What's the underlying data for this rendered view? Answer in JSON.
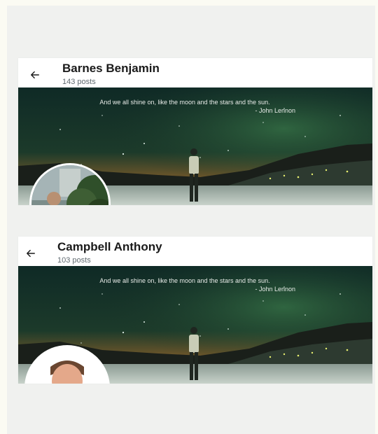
{
  "profiles": [
    {
      "name": "Barnes Benjamin",
      "posts": "143 posts",
      "quote_line1": "And we all shine on, like the moon and the stars and the sun.",
      "quote_line2": "- John Lennon"
    },
    {
      "name": "Campbell Anthony",
      "posts": "103 posts",
      "quote_line1": "And we all shine on, like the moon and the stars and the sun.",
      "quote_line2": "- John Lennon"
    }
  ],
  "icons": {
    "back": "arrow-left-icon"
  },
  "colors": {
    "background": "#f0f1ef",
    "card": "#ffffff",
    "title": "#1a1a1a",
    "subtitle": "#606a70"
  }
}
